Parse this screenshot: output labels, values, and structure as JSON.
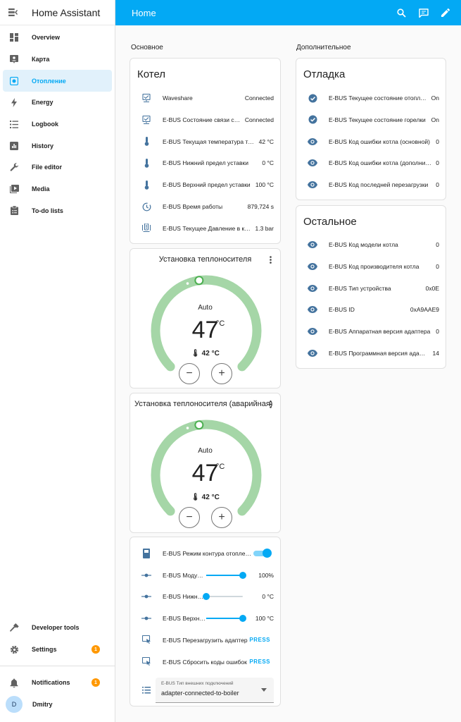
{
  "app": {
    "title": "Home Assistant"
  },
  "topbar": {
    "title": "Home"
  },
  "sidebar": {
    "items": [
      {
        "label": "Overview",
        "icon": "dashboard-icon"
      },
      {
        "label": "Карта",
        "icon": "map-icon"
      },
      {
        "label": "Отопление",
        "icon": "heating-icon",
        "active": true
      },
      {
        "label": "Energy",
        "icon": "lightning-icon"
      },
      {
        "label": "Logbook",
        "icon": "logbook-icon"
      },
      {
        "label": "History",
        "icon": "history-icon"
      },
      {
        "label": "File editor",
        "icon": "wrench-icon"
      },
      {
        "label": "Media",
        "icon": "media-icon"
      },
      {
        "label": "To-do lists",
        "icon": "todo-icon"
      }
    ],
    "developer_tools": "Developer tools",
    "settings": "Settings",
    "settings_badge": "1",
    "notifications": "Notifications",
    "notifications_badge": "1",
    "user": "Dmitry",
    "user_initial": "D"
  },
  "columns": {
    "left_title": "Основное",
    "right_title": "Дополнительное"
  },
  "kotel": {
    "title": "Котел",
    "rows": [
      {
        "name": "Waveshare",
        "value": "Connected",
        "icon": "connection-icon"
      },
      {
        "name": "E-BUS Состояние связи с котлом",
        "value": "Connected",
        "icon": "connection-icon"
      },
      {
        "name": "E-BUS Текущая температура теплоносителя",
        "value": "42 °C",
        "icon": "thermometer-icon"
      },
      {
        "name": "E-BUS Нижний предел уставки",
        "value": "0 °C",
        "icon": "thermometer-icon"
      },
      {
        "name": "E-BUS Верхний предел уставки",
        "value": "100 °C",
        "icon": "thermometer-icon"
      },
      {
        "name": "E-BUS Время работы",
        "value": "879,724 s",
        "icon": "clock-icon"
      },
      {
        "name": "E-BUS Текущее Давление в контуре",
        "value": "1.3 bar",
        "icon": "pressure-icon"
      }
    ]
  },
  "thermostat1": {
    "title": "Установка теплоносителя",
    "mode": "Auto",
    "target": "47",
    "unit": "°C",
    "current": "42 °C",
    "fraction": 0.47
  },
  "thermostat2": {
    "title": "Установка теплоносителя (аварийная)",
    "mode": "Auto",
    "target": "47",
    "unit": "°C",
    "current": "42 °C",
    "fraction": 0.47
  },
  "controls": {
    "rows": [
      {
        "name": "E-BUS Режим контура отопления",
        "type": "toggle",
        "on": true
      },
      {
        "name": "E-BUS Модуляция",
        "type": "slider",
        "value": "100%",
        "fraction": 1.0
      },
      {
        "name": "E-BUS Нижний предел",
        "type": "slider",
        "value": "0 °C",
        "fraction": 0.0
      },
      {
        "name": "E-BUS Верхний предел",
        "type": "slider",
        "value": "100 °C",
        "fraction": 1.0
      },
      {
        "name": "E-BUS Перезагрузить адаптер",
        "type": "button",
        "value": "PRESS"
      },
      {
        "name": "E-BUS Сбросить коды ошибок",
        "type": "button",
        "value": "PRESS"
      }
    ],
    "select": {
      "label": "E-BUS Тип внешних подключений",
      "value": "adapter-connected-to-boiler"
    }
  },
  "debug": {
    "title": "Отладка",
    "rows": [
      {
        "name": "E-BUS Текущее состояние отопления",
        "value": "On",
        "icon": "check-circle-icon"
      },
      {
        "name": "E-BUS Текущее состояние горелки",
        "value": "On",
        "icon": "check-circle-icon"
      },
      {
        "name": "E-BUS Код ошибки котла (основной)",
        "value": "0",
        "icon": "eye-icon"
      },
      {
        "name": "E-BUS Код ошибки котла (дополнительный)",
        "value": "0",
        "icon": "eye-icon"
      },
      {
        "name": "E-BUS Код последней перезагрузки",
        "value": "0",
        "icon": "eye-icon"
      }
    ]
  },
  "other": {
    "title": "Остальное",
    "rows": [
      {
        "name": "E-BUS Код модели котла",
        "value": "0",
        "icon": "eye-icon"
      },
      {
        "name": "E-BUS Код производителя котла",
        "value": "0",
        "icon": "eye-icon"
      },
      {
        "name": "E-BUS Тип устройства",
        "value": "0x0E",
        "icon": "eye-icon"
      },
      {
        "name": "E-BUS ID",
        "value": "0xA9AAE9",
        "icon": "eye-icon"
      },
      {
        "name": "E-BUS Аппаратная версия адаптера",
        "value": "0",
        "icon": "eye-icon"
      },
      {
        "name": "E-BUS Программная версия адаптера",
        "value": "14",
        "icon": "eye-icon"
      }
    ]
  },
  "colors": {
    "accent": "#03a9f4",
    "heat_arc": "#a5d6a7",
    "icon": "#44739e",
    "badge": "#ff9800"
  }
}
